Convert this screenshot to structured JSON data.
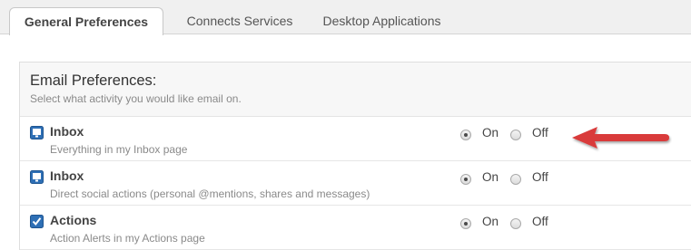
{
  "tabs": [
    {
      "label": "General Preferences",
      "active": true
    },
    {
      "label": "Connects Services",
      "active": false
    },
    {
      "label": "Desktop Applications",
      "active": false
    }
  ],
  "email_prefs": {
    "title": "Email Preferences:",
    "subtitle": "Select what activity you would like email on.",
    "rows": [
      {
        "name": "Inbox",
        "desc": "Everything in my Inbox page",
        "icon": "monitor-icon",
        "selected": "On"
      },
      {
        "name": "Inbox",
        "desc": "Direct social actions (personal @mentions, shares and messages)",
        "icon": "monitor-icon",
        "selected": "On"
      },
      {
        "name": "Actions",
        "desc": "Action Alerts in my Actions page",
        "icon": "checkbox-icon",
        "selected": "On"
      }
    ],
    "on_label": "On",
    "off_label": "Off"
  },
  "colors": {
    "accent_blue": "#2e6fb5",
    "arrow_red": "#d93b3b"
  }
}
